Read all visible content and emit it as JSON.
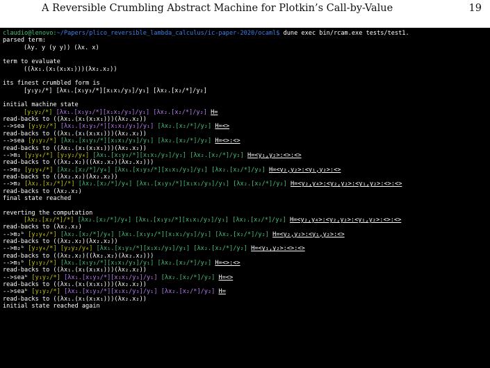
{
  "header": {
    "title": "A Reversible Crumbling Abstract Machine for Plotkin’s Call-by-Value",
    "page_number": "19"
  },
  "terminal": {
    "cmd_user": "claudio@lenovo:",
    "cmd_path": "~/Papers/plico_reversible_lambda_calculus/ic-paper-2020/ocaml$",
    "cmd_rest": " dune exec bin/rcam.exe tests/test1.",
    "parsed_label": "parsed term:",
    "parsed_term": "(λy. y (y y)) (λx. x)",
    "eval_label": "term to evaluate",
    "eval_term": "((λx₁.(x₁(x₁x₁)))(λx₂.x₂))",
    "crumbled_label": "its finest crumbled form is",
    "crumbled_term": "[y₁y₂/*] [λx₁.[x₁y₃/*][x₁x₁/y₃]/y₁] [λx₂.[x₂/*]/y₂]",
    "initial_label": "initial machine state",
    "s1": {
      "a": "[y₁y₂/*]",
      "b": "[λx₁.[x₁y₃/*][x₁x₁/y₃]/y₁]",
      "c": "[λx₂.[x₂/*]/y₂]",
      "h": "H="
    },
    "rb1": "read-backs to ((λx₁.(x₁(x₁x₁)))(λx₂.x₂))",
    "s2": {
      "arrow": "-->sea",
      "a": "[y₁y₂/*]",
      "b": "[λx₁.[x₁y₃/*][x₁x₁/y₃]/y₁]",
      "c": "[λx₂.[x₂/*]/y₂]",
      "h": "H=<>"
    },
    "rb2": "read-backs to ((λx₁.(x₁(x₁x₁)))(λx₂.x₂))",
    "s3": {
      "arrow": "-->sea",
      "a": "[y₁y₂/*]",
      "b": "[λx₁.[x₁y₃/*][x₁x₁/y₃]/y₁]",
      "c": "[λx₂.[x₂/*]/y₂]",
      "h": "H=<>:<>"
    },
    "rb3": "read-backs to ((λx₁.(x₁(x₁x₁)))(λx₂.x₂))",
    "s4": {
      "arrow": "-->m₁",
      "a": "[y₂y₄/*]",
      "b": "[y₂y₂/y₄]",
      "c": "[λx₁.[x₁y₃/*][x₁x₁/y₃]/y₁]",
      "d": "[λx₂.[x₂/*]/y₂]",
      "h": "H=<y₁,y₂>:<>:<>"
    },
    "rb4": "read-backs to ((λx₂.x₂)((λx₂.x₂)(λx₂.x₂)))",
    "s5": {
      "arrow": "-->m₂",
      "a": "[y₂y₄/*]",
      "b": "[λx₂.[x₂/*]/y₄]",
      "c": "[λx₁.[x₁y₃/*][x₁x₁/y₃]/y₁]",
      "d": "[λx₂.[x₂/*]/y₂]",
      "h": "H=<y₂,y₂>:<y₁,y₂>:<>"
    },
    "rb5": "read-backs to ((λx₂.x₂)(λx₂.x₂))",
    "s6": {
      "arrow": "-->m₂",
      "a": "[λx₂.[x₂/*]/*]",
      "b": "[λx₂.[x₂/*]/y₄]",
      "c": "[λx₁.[x₁y₃/*][x₁x₁/y₃]/y₁]",
      "d": "[λx₂.[x₂/*]/y₂]",
      "h": "H=<y₂,y₄>:<y₂,y₂>:<y₁,y₂>:<>:<>"
    },
    "rb6": "read-backs to (λx₂.x₂)",
    "final": "final state reached",
    "revert_label": "reverting the computation",
    "r0": {
      "a": "[λx₂.[x₂/*]/*]",
      "b": "[λx₂.[x₂/*]/y₄]",
      "c": "[λx₁.[x₁y₃/*][x₁x₁/y₃]/y₁]",
      "d": "[λx₂.[x₂/*]/y₂]",
      "h": "H=<y₂,y₄>:<y₂,y₂>:<y₁,y₂>:<>:<>"
    },
    "rr0": "read-backs to (λx₂.x₂)",
    "r1": {
      "arrow": "-->m₂ᵇ",
      "a": "[y₂y₄/*]",
      "b": "[λx₂.[x₂/*]/y₄]",
      "c": "[λx₁.[x₁y₃/*][x₁x₁/y₃]/y₁]",
      "d": "[λx₂.[x₂/*]/y₂]",
      "h": "H=<y₂,y₂>:<y₁,y₂>:<>"
    },
    "rr1": "read-backs to ((λx₂.x₂)(λx₂.x₂))",
    "r2": {
      "arrow": "-->m₂ᵇ",
      "a": "[y₂y₄/*]",
      "b": "[y₂y₂/y₄]",
      "c": "[λx₁.[x₁y₃/*][x₁x₁/y₃]/y₁]",
      "d": "[λx₂.[x₂/*]/y₂]",
      "h": "H=<y₁,y₂>:<>:<>"
    },
    "rr2": "read-backs to ((λx₂.x₂)((λx₂.x₂)(λx₂.x₂)))",
    "r3": {
      "arrow": "-->m₁ᵇ",
      "a": "[y₁y₂/*]",
      "b": "[λx₁.[x₁y₃/*][x₁x₁/y₃]/y₁]",
      "c": "[λx₂.[x₂/*]/y₂]",
      "h": "H=<>:<>"
    },
    "rr3": "read-backs to ((λx₁.(x₁(x₁x₁)))(λx₂.x₂))",
    "r4": {
      "arrow": "-->seaᵇ",
      "a": "[y₁y₂/*]",
      "b": "[λx₁.[x₁y₃/*][x₁x₁/y₃]/y₁]",
      "c": "[λx₂.[x₂/*]/y₂]",
      "h": "H=<>"
    },
    "rr4": "read-backs to ((λx₁.(x₁(x₁x₁)))(λx₂.x₂))",
    "r5": {
      "arrow": "-->seaᵇ",
      "a": "[y₁y₂/*]",
      "b": "[λx₁.[x₁y₃/*][x₁x₁/y₃]/y₁]",
      "c": "[λx₂.[x₂/*]/y₂]",
      "h": "H="
    },
    "rr5": "read-backs to ((λx₁.(x₁(x₁x₁)))(λx₂.x₂))",
    "again": "initial state reached again"
  }
}
